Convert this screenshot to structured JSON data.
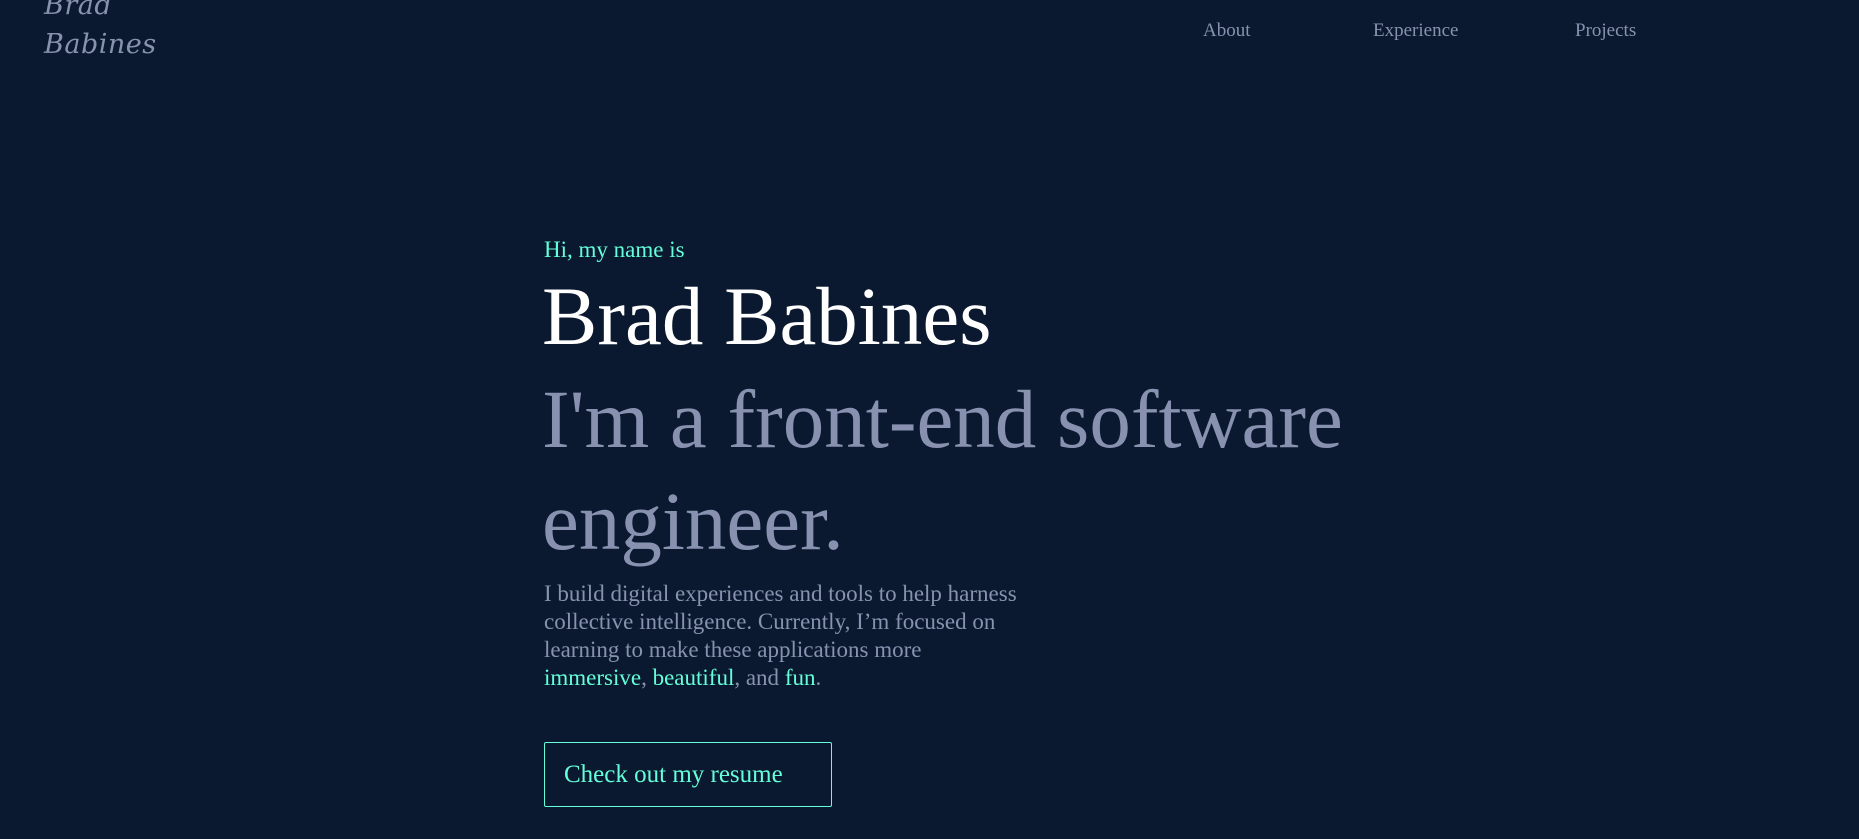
{
  "logo": {
    "line1": "Brad",
    "line2": "Babines"
  },
  "nav": {
    "items": [
      {
        "label": "About"
      },
      {
        "label": "Experience"
      },
      {
        "label": "Projects"
      }
    ]
  },
  "hero": {
    "greeting": "Hi, my name is",
    "name": "Brad Babines",
    "tagline": "I'm a front-end software engineer.",
    "intro": {
      "text": "I build digital experiences and tools to help harness collective intelligence. Currently, I’m focused on learning to make these applications more",
      "highlight1": "immersive",
      "sep1": ",",
      "highlight2": "beautiful",
      "sep2": ", and",
      "highlight3": "fun",
      "end": "."
    },
    "resume_label": "Check out my resume"
  },
  "colors": {
    "background": "#0a192f",
    "accent": "#64ffda",
    "muted_text": "#8892b0",
    "heading_text": "#ffffff"
  }
}
